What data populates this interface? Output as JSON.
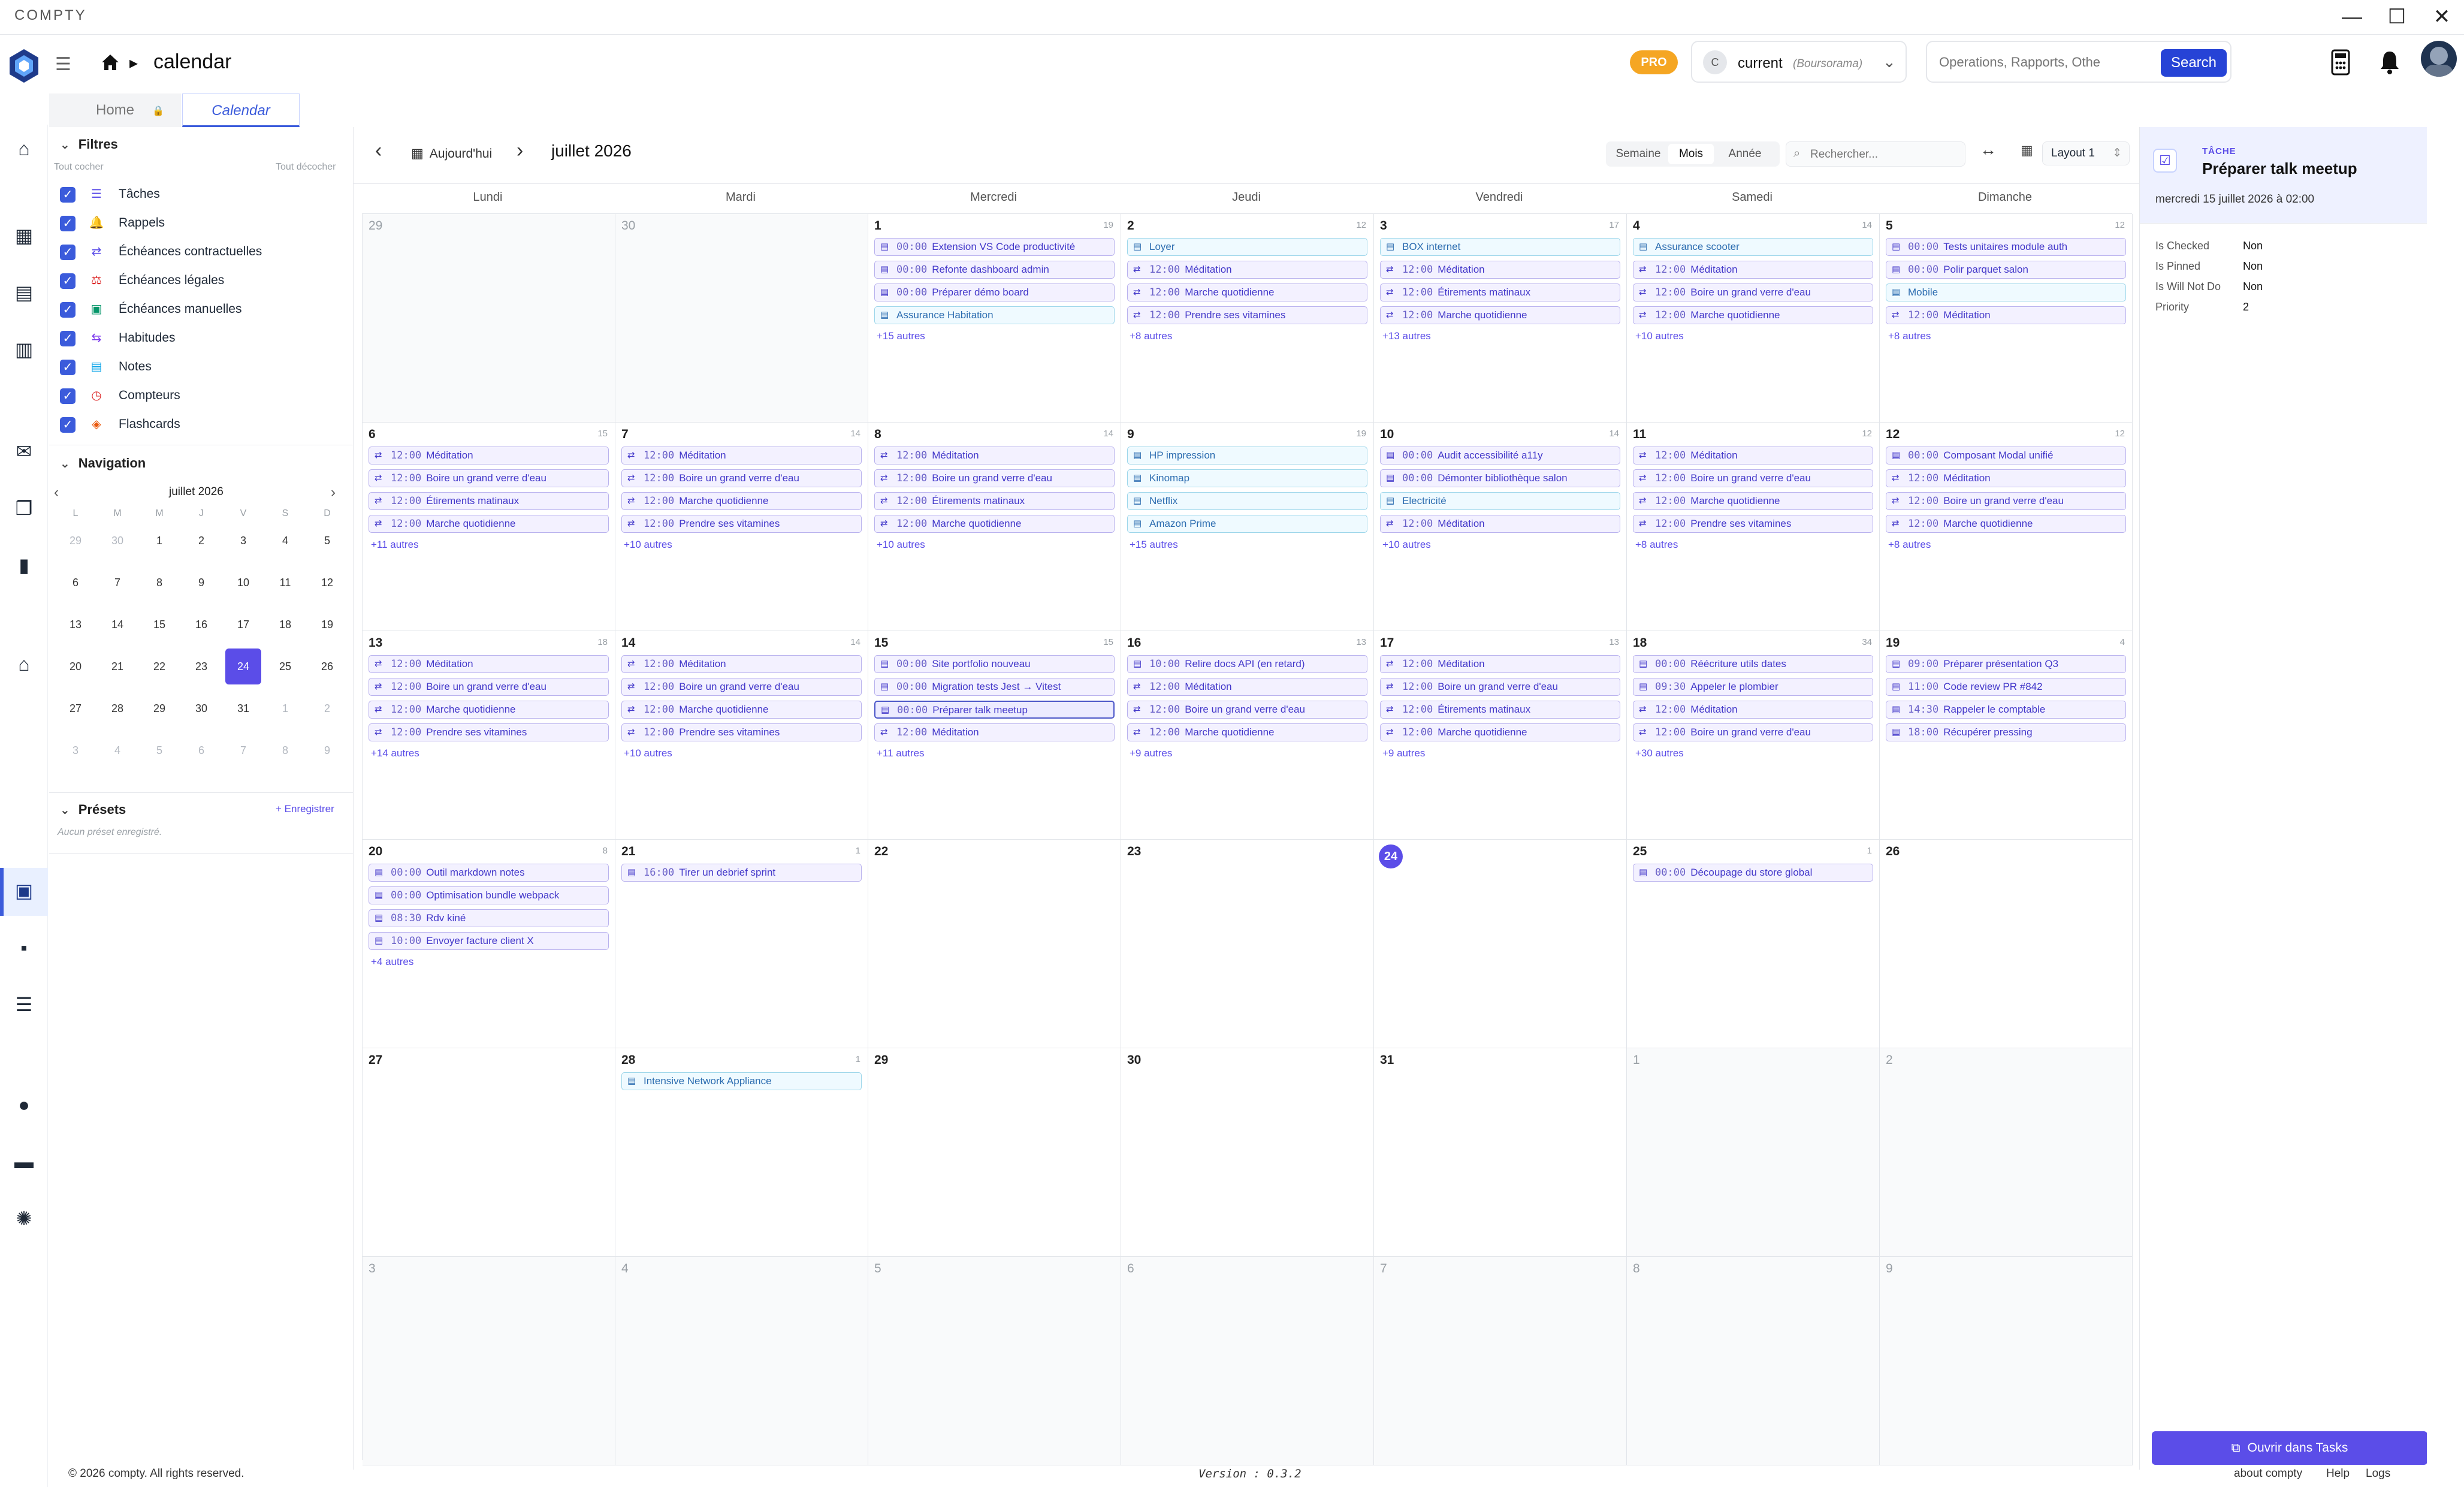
{
  "window": {
    "app_name": "COMPTY",
    "min": "—",
    "max": "☐",
    "close": "✕"
  },
  "header": {
    "page_title": "calendar",
    "pro_badge": "PRO",
    "account_initial": "C",
    "account_name": "current",
    "account_bank": "(Boursorama)",
    "search_placeholder": "Operations, Rapports, Othe",
    "search_button": "Search"
  },
  "tabs": [
    {
      "label": "Home"
    },
    {
      "label": "Calendar"
    }
  ],
  "filters": {
    "title": "Filtres",
    "check_all": "Tout cocher",
    "uncheck_all": "Tout décocher",
    "items": [
      {
        "label": "Tâches",
        "icon": "☰",
        "color": "#5b4de8"
      },
      {
        "label": "Rappels",
        "icon": "🔔",
        "color": "#f59e0b"
      },
      {
        "label": "Échéances contractuelles",
        "icon": "⇄",
        "color": "#5b4de8"
      },
      {
        "label": "Échéances légales",
        "icon": "⚖",
        "color": "#dc2626"
      },
      {
        "label": "Échéances manuelles",
        "icon": "▣",
        "color": "#059669"
      },
      {
        "label": "Habitudes",
        "icon": "⇆",
        "color": "#7c3aed"
      },
      {
        "label": "Notes",
        "icon": "▤",
        "color": "#0ea5e9"
      },
      {
        "label": "Compteurs",
        "icon": "◷",
        "color": "#dc2626"
      },
      {
        "label": "Flashcards",
        "icon": "◈",
        "color": "#ea580c"
      }
    ]
  },
  "navigation": {
    "title": "Navigation",
    "month_label": "juillet 2026",
    "weekday_letters": [
      "L",
      "M",
      "M",
      "J",
      "V",
      "S",
      "D"
    ],
    "weeks": [
      [
        "29",
        "30",
        "1",
        "2",
        "3",
        "4",
        "5"
      ],
      [
        "6",
        "7",
        "8",
        "9",
        "10",
        "11",
        "12"
      ],
      [
        "13",
        "14",
        "15",
        "16",
        "17",
        "18",
        "19"
      ],
      [
        "20",
        "21",
        "22",
        "23",
        "24",
        "25",
        "26"
      ],
      [
        "27",
        "28",
        "29",
        "30",
        "31",
        "1",
        "2"
      ],
      [
        "3",
        "4",
        "5",
        "6",
        "7",
        "8",
        "9"
      ]
    ]
  },
  "presets": {
    "title": "Présets",
    "save_link": "+ Enregistrer",
    "empty": "Aucun préset enregistré."
  },
  "toolbar": {
    "today": "Aujourd'hui",
    "month_title": "juillet 2026",
    "views": [
      "Semaine",
      "Mois",
      "Année"
    ],
    "search_placeholder": "Rechercher...",
    "layout": "Layout 1"
  },
  "day_names": [
    "Lundi",
    "Mardi",
    "Mercredi",
    "Jeudi",
    "Vendredi",
    "Samedi",
    "Dimanche"
  ],
  "calendar": {
    "weeks": [
      [
        {
          "d": "29",
          "other": true,
          "count": "",
          "events": [],
          "more": ""
        },
        {
          "d": "30",
          "other": true,
          "count": "",
          "events": [],
          "more": ""
        },
        {
          "d": "1",
          "count": "19",
          "events": [
            {
              "t": "00:00",
              "l": "Extension VS Code productivité",
              "k": "task"
            },
            {
              "t": "00:00",
              "l": "Refonte dashboard admin",
              "k": "task"
            },
            {
              "t": "00:00",
              "l": "Préparer démo board",
              "k": "task"
            },
            {
              "t": "",
              "l": "Assurance Habitation",
              "k": "doc"
            }
          ],
          "more": "+15 autres"
        },
        {
          "d": "2",
          "count": "12",
          "events": [
            {
              "t": "",
              "l": "Loyer",
              "k": "doc"
            },
            {
              "t": "12:00",
              "l": "Méditation",
              "k": "habit"
            },
            {
              "t": "12:00",
              "l": "Marche quotidienne",
              "k": "habit"
            },
            {
              "t": "12:00",
              "l": "Prendre ses vitamines",
              "k": "habit"
            }
          ],
          "more": "+8 autres"
        },
        {
          "d": "3",
          "count": "17",
          "events": [
            {
              "t": "",
              "l": "BOX internet",
              "k": "doc"
            },
            {
              "t": "12:00",
              "l": "Méditation",
              "k": "habit"
            },
            {
              "t": "12:00",
              "l": "Étirements matinaux",
              "k": "habit"
            },
            {
              "t": "12:00",
              "l": "Marche quotidienne",
              "k": "habit"
            }
          ],
          "more": "+13 autres"
        },
        {
          "d": "4",
          "count": "14",
          "events": [
            {
              "t": "",
              "l": "Assurance scooter",
              "k": "doc"
            },
            {
              "t": "12:00",
              "l": "Méditation",
              "k": "habit"
            },
            {
              "t": "12:00",
              "l": "Boire un grand verre d'eau",
              "k": "habit"
            },
            {
              "t": "12:00",
              "l": "Marche quotidienne",
              "k": "habit"
            }
          ],
          "more": "+10 autres"
        },
        {
          "d": "5",
          "count": "12",
          "events": [
            {
              "t": "00:00",
              "l": "Tests unitaires module auth",
              "k": "task"
            },
            {
              "t": "00:00",
              "l": "Polir parquet salon",
              "k": "task"
            },
            {
              "t": "",
              "l": "Mobile",
              "k": "doc"
            },
            {
              "t": "12:00",
              "l": "Méditation",
              "k": "habit"
            }
          ],
          "more": "+8 autres"
        }
      ],
      [
        {
          "d": "6",
          "count": "15",
          "events": [
            {
              "t": "12:00",
              "l": "Méditation",
              "k": "habit"
            },
            {
              "t": "12:00",
              "l": "Boire un grand verre d'eau",
              "k": "habit"
            },
            {
              "t": "12:00",
              "l": "Étirements matinaux",
              "k": "habit"
            },
            {
              "t": "12:00",
              "l": "Marche quotidienne",
              "k": "habit"
            }
          ],
          "more": "+11 autres"
        },
        {
          "d": "7",
          "count": "14",
          "events": [
            {
              "t": "12:00",
              "l": "Méditation",
              "k": "habit"
            },
            {
              "t": "12:00",
              "l": "Boire un grand verre d'eau",
              "k": "habit"
            },
            {
              "t": "12:00",
              "l": "Marche quotidienne",
              "k": "habit"
            },
            {
              "t": "12:00",
              "l": "Prendre ses vitamines",
              "k": "habit"
            }
          ],
          "more": "+10 autres"
        },
        {
          "d": "8",
          "count": "14",
          "events": [
            {
              "t": "12:00",
              "l": "Méditation",
              "k": "habit"
            },
            {
              "t": "12:00",
              "l": "Boire un grand verre d'eau",
              "k": "habit"
            },
            {
              "t": "12:00",
              "l": "Étirements matinaux",
              "k": "habit"
            },
            {
              "t": "12:00",
              "l": "Marche quotidienne",
              "k": "habit"
            }
          ],
          "more": "+10 autres"
        },
        {
          "d": "9",
          "count": "19",
          "events": [
            {
              "t": "",
              "l": "HP impression",
              "k": "doc"
            },
            {
              "t": "",
              "l": "Kinomap",
              "k": "doc"
            },
            {
              "t": "",
              "l": "Netflix",
              "k": "doc"
            },
            {
              "t": "",
              "l": "Amazon Prime",
              "k": "doc"
            }
          ],
          "more": "+15 autres"
        },
        {
          "d": "10",
          "count": "14",
          "events": [
            {
              "t": "00:00",
              "l": "Audit accessibilité a11y",
              "k": "task"
            },
            {
              "t": "00:00",
              "l": "Démonter bibliothèque salon",
              "k": "task"
            },
            {
              "t": "",
              "l": "Electricité",
              "k": "doc"
            },
            {
              "t": "12:00",
              "l": "Méditation",
              "k": "habit"
            }
          ],
          "more": "+10 autres"
        },
        {
          "d": "11",
          "count": "12",
          "events": [
            {
              "t": "12:00",
              "l": "Méditation",
              "k": "habit"
            },
            {
              "t": "12:00",
              "l": "Boire un grand verre d'eau",
              "k": "habit"
            },
            {
              "t": "12:00",
              "l": "Marche quotidienne",
              "k": "habit"
            },
            {
              "t": "12:00",
              "l": "Prendre ses vitamines",
              "k": "habit"
            }
          ],
          "more": "+8 autres"
        },
        {
          "d": "12",
          "count": "12",
          "events": [
            {
              "t": "00:00",
              "l": "Composant Modal unifié",
              "k": "task"
            },
            {
              "t": "12:00",
              "l": "Méditation",
              "k": "habit"
            },
            {
              "t": "12:00",
              "l": "Boire un grand verre d'eau",
              "k": "habit"
            },
            {
              "t": "12:00",
              "l": "Marche quotidienne",
              "k": "habit"
            }
          ],
          "more": "+8 autres"
        }
      ],
      [
        {
          "d": "13",
          "count": "18",
          "events": [
            {
              "t": "12:00",
              "l": "Méditation",
              "k": "habit"
            },
            {
              "t": "12:00",
              "l": "Boire un grand verre d'eau",
              "k": "habit"
            },
            {
              "t": "12:00",
              "l": "Marche quotidienne",
              "k": "habit"
            },
            {
              "t": "12:00",
              "l": "Prendre ses vitamines",
              "k": "habit"
            }
          ],
          "more": "+14 autres"
        },
        {
          "d": "14",
          "count": "14",
          "events": [
            {
              "t": "12:00",
              "l": "Méditation",
              "k": "habit"
            },
            {
              "t": "12:00",
              "l": "Boire un grand verre d'eau",
              "k": "habit"
            },
            {
              "t": "12:00",
              "l": "Marche quotidienne",
              "k": "habit"
            },
            {
              "t": "12:00",
              "l": "Prendre ses vitamines",
              "k": "habit"
            }
          ],
          "more": "+10 autres"
        },
        {
          "d": "15",
          "count": "15",
          "events": [
            {
              "t": "00:00",
              "l": "Site portfolio nouveau",
              "k": "task"
            },
            {
              "t": "00:00",
              "l": "Migration tests Jest → Vitest",
              "k": "task"
            },
            {
              "t": "00:00",
              "l": "Préparer talk meetup",
              "k": "task",
              "sel": true
            },
            {
              "t": "12:00",
              "l": "Méditation",
              "k": "habit"
            }
          ],
          "more": "+11 autres"
        },
        {
          "d": "16",
          "count": "13",
          "events": [
            {
              "t": "10:00",
              "l": "Relire docs API (en retard)",
              "k": "task"
            },
            {
              "t": "12:00",
              "l": "Méditation",
              "k": "habit"
            },
            {
              "t": "12:00",
              "l": "Boire un grand verre d'eau",
              "k": "habit"
            },
            {
              "t": "12:00",
              "l": "Marche quotidienne",
              "k": "habit"
            }
          ],
          "more": "+9 autres"
        },
        {
          "d": "17",
          "count": "13",
          "events": [
            {
              "t": "12:00",
              "l": "Méditation",
              "k": "habit"
            },
            {
              "t": "12:00",
              "l": "Boire un grand verre d'eau",
              "k": "habit"
            },
            {
              "t": "12:00",
              "l": "Étirements matinaux",
              "k": "habit"
            },
            {
              "t": "12:00",
              "l": "Marche quotidienne",
              "k": "habit"
            }
          ],
          "more": "+9 autres"
        },
        {
          "d": "18",
          "count": "34",
          "events": [
            {
              "t": "00:00",
              "l": "Réécriture utils dates",
              "k": "task"
            },
            {
              "t": "09:30",
              "l": "Appeler le plombier",
              "k": "task"
            },
            {
              "t": "12:00",
              "l": "Méditation",
              "k": "habit"
            },
            {
              "t": "12:00",
              "l": "Boire un grand verre d'eau",
              "k": "habit"
            }
          ],
          "more": "+30 autres"
        },
        {
          "d": "19",
          "count": "4",
          "events": [
            {
              "t": "09:00",
              "l": "Préparer présentation Q3",
              "k": "task"
            },
            {
              "t": "11:00",
              "l": "Code review PR #842",
              "k": "task"
            },
            {
              "t": "14:30",
              "l": "Rappeler le comptable",
              "k": "task"
            },
            {
              "t": "18:00",
              "l": "Récupérer pressing",
              "k": "task"
            }
          ],
          "more": ""
        }
      ],
      [
        {
          "d": "20",
          "count": "8",
          "events": [
            {
              "t": "00:00",
              "l": "Outil markdown notes",
              "k": "task"
            },
            {
              "t": "00:00",
              "l": "Optimisation bundle webpack",
              "k": "task"
            },
            {
              "t": "08:30",
              "l": "Rdv kiné",
              "k": "task"
            },
            {
              "t": "10:00",
              "l": "Envoyer facture client X",
              "k": "task"
            }
          ],
          "more": "+4 autres"
        },
        {
          "d": "21",
          "count": "1",
          "events": [
            {
              "t": "16:00",
              "l": "Tirer un debrief sprint",
              "k": "task"
            }
          ],
          "more": ""
        },
        {
          "d": "22",
          "count": "",
          "events": [],
          "more": ""
        },
        {
          "d": "23",
          "count": "",
          "events": [],
          "more": ""
        },
        {
          "d": "24",
          "today": true,
          "count": "",
          "events": [],
          "more": ""
        },
        {
          "d": "25",
          "count": "1",
          "events": [
            {
              "t": "00:00",
              "l": "Découpage du store global",
              "k": "task"
            }
          ],
          "more": ""
        },
        {
          "d": "26",
          "count": "",
          "events": [],
          "more": ""
        }
      ],
      [
        {
          "d": "27",
          "count": "",
          "events": [],
          "more": ""
        },
        {
          "d": "28",
          "count": "1",
          "events": [
            {
              "t": "",
              "l": "Intensive Network Appliance",
              "k": "doc"
            }
          ],
          "more": ""
        },
        {
          "d": "29",
          "count": "",
          "events": [],
          "more": ""
        },
        {
          "d": "30",
          "count": "",
          "events": [],
          "more": ""
        },
        {
          "d": "31",
          "count": "",
          "events": [],
          "more": ""
        },
        {
          "d": "1",
          "other": true,
          "count": "",
          "events": [],
          "more": ""
        },
        {
          "d": "2",
          "other": true,
          "count": "",
          "events": [],
          "more": ""
        }
      ],
      [
        {
          "d": "3",
          "other": true,
          "count": "",
          "events": [],
          "more": ""
        },
        {
          "d": "4",
          "other": true,
          "count": "",
          "events": [],
          "more": ""
        },
        {
          "d": "5",
          "other": true,
          "count": "",
          "events": [],
          "more": ""
        },
        {
          "d": "6",
          "other": true,
          "count": "",
          "events": [],
          "more": ""
        },
        {
          "d": "7",
          "other": true,
          "count": "",
          "events": [],
          "more": ""
        },
        {
          "d": "8",
          "other": true,
          "count": "",
          "events": [],
          "more": ""
        },
        {
          "d": "9",
          "other": true,
          "count": "",
          "events": [],
          "more": ""
        }
      ]
    ]
  },
  "detail": {
    "kind": "TÂCHE",
    "title": "Préparer talk meetup",
    "date": "mercredi 15 juillet 2026 à 02:00",
    "props": [
      {
        "k": "Is Checked",
        "v": "Non"
      },
      {
        "k": "Is Pinned",
        "v": "Non"
      },
      {
        "k": "Is Will Not Do",
        "v": "Non"
      },
      {
        "k": "Priority",
        "v": "2"
      }
    ],
    "open_button": "Ouvrir dans Tasks"
  },
  "footer": {
    "copyright": "© 2026 compty. All rights reserved.",
    "version": "Version : 0.3.2",
    "links": [
      "about compty",
      "Help",
      "Logs"
    ]
  },
  "colors": {
    "accent": "#5b4de8",
    "primary_button": "#2643d6",
    "pro": "#f5a623"
  }
}
